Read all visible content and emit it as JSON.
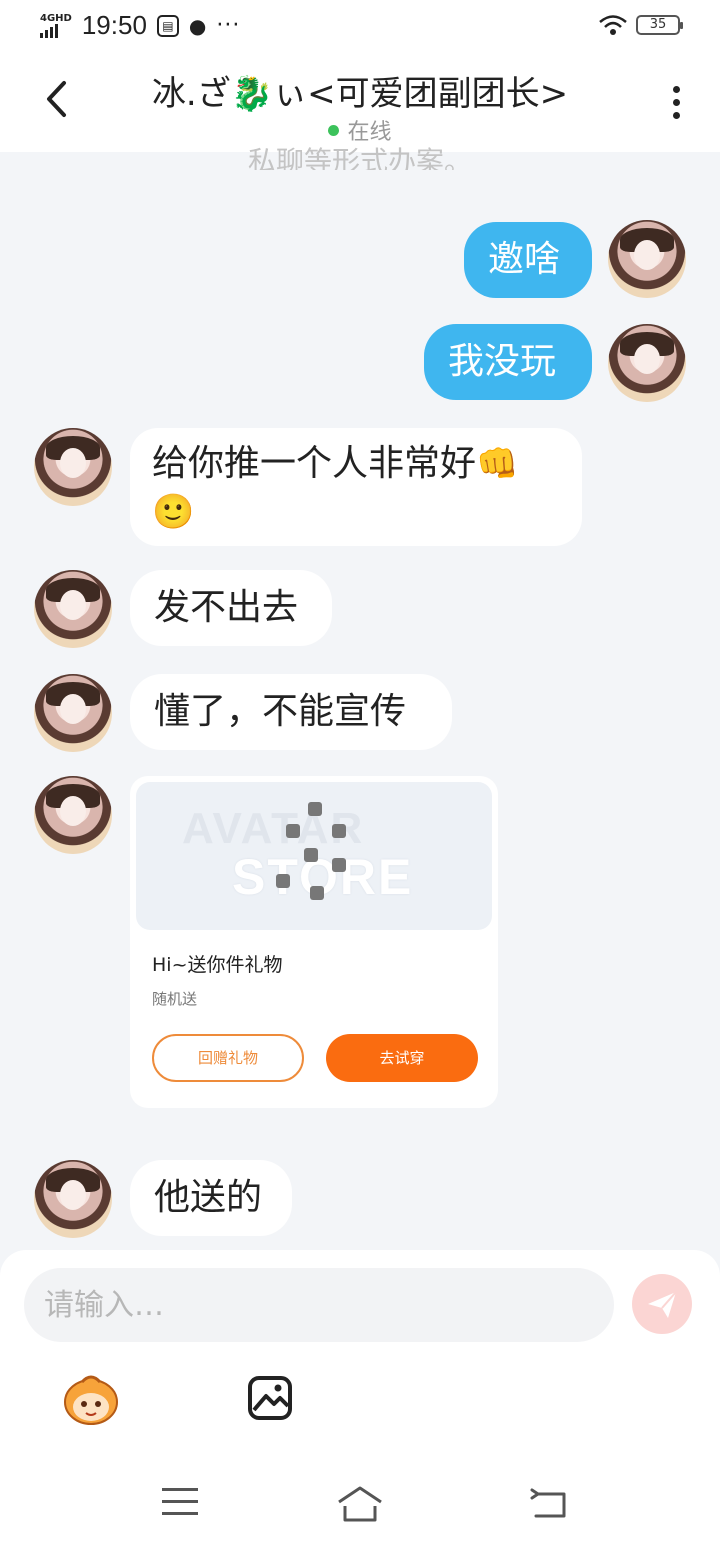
{
  "status_bar": {
    "network": "4GHD",
    "time": "19:50",
    "battery": "35",
    "more": "···"
  },
  "header": {
    "title": "冰.ざ🐉ぃ<可爱团副团长>",
    "status": "在线",
    "back_icon": "chevron-left-icon",
    "more_icon": "more-vertical-icon",
    "online_color": "#3cc25b"
  },
  "chat": {
    "notice": "私聊等形式办案。",
    "messages": [
      {
        "from": "me",
        "text": "邀啥"
      },
      {
        "from": "me",
        "text": "我没玩"
      },
      {
        "from": "other",
        "text": "给你推一个人非常好",
        "emoji": "👊",
        "emoji2": "🙂"
      },
      {
        "from": "other",
        "text": "发不出去"
      },
      {
        "from": "other",
        "text": "懂了，不能宣传"
      },
      {
        "from": "other",
        "text": "他送的"
      }
    ],
    "gift_card": {
      "watermark_line1": "AVATAR",
      "watermark_line2": "STORE",
      "title": "Hi~送你件礼物",
      "subtitle": "随机送",
      "return_gift_label": "回赠礼物",
      "try_on_label": "去试穿",
      "accent_color": "#fa6c10"
    },
    "me_bubble_color": "#3fb6ef"
  },
  "composer": {
    "placeholder": "请输入…",
    "send_icon": "send-icon",
    "tools": [
      "mascot-icon",
      "image-icon"
    ]
  },
  "system_nav": [
    "menu-icon",
    "home-icon",
    "back-icon"
  ]
}
